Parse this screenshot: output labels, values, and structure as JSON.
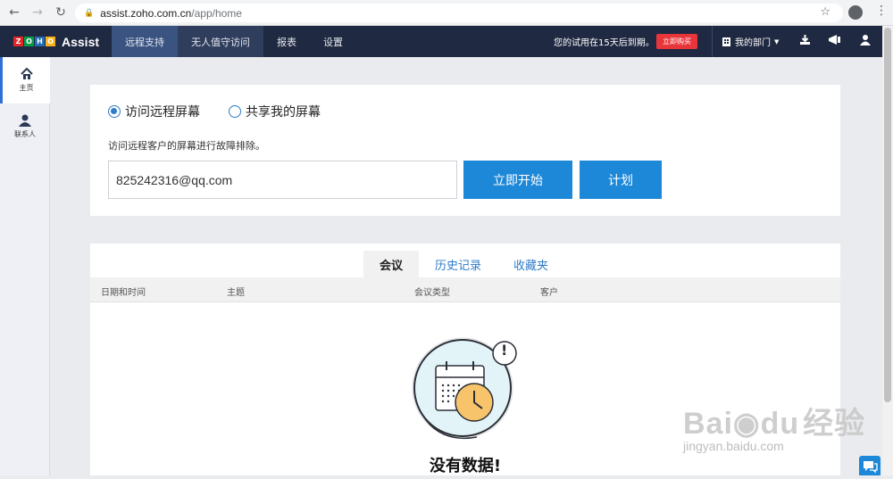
{
  "browser": {
    "url_host": "assist.zoho.com.cn",
    "url_path": "/app/home"
  },
  "header": {
    "logo_letters": [
      "Z",
      "O",
      "H",
      "O"
    ],
    "logo_colors": [
      "#e42527",
      "#089949",
      "#226db4",
      "#f9b21d"
    ],
    "logo_product": "Assist",
    "nav": [
      {
        "label": "远程支持"
      },
      {
        "label": "无人值守访问"
      },
      {
        "label": "报表"
      },
      {
        "label": "设置"
      }
    ],
    "trial_text": "您的试用在15天后到期。",
    "buy_label": "立即购买",
    "department_label": "我的部门"
  },
  "sidebar": {
    "items": [
      {
        "label": "主页",
        "icon": "home-icon"
      },
      {
        "label": "联系人",
        "icon": "contacts-icon"
      }
    ]
  },
  "session": {
    "option_remote": "访问远程屏幕",
    "option_share": "共享我的屏幕",
    "description": "访问远程客户的屏幕进行故障排除。",
    "email_value": "825242316@qq.com",
    "start_label": "立即开始",
    "schedule_label": "计划"
  },
  "meetings": {
    "tabs": [
      {
        "label": "会议"
      },
      {
        "label": "历史记录"
      },
      {
        "label": "收藏夹"
      }
    ],
    "columns": [
      "日期和时间",
      "主题",
      "会议类型",
      "客户"
    ],
    "empty_text": "没有数据!",
    "exclaim": "!"
  },
  "colors": {
    "accent": "#1e88d8",
    "header_bg": "#1f2941",
    "active_tab": "#3a5381",
    "buy": "#e8353a"
  },
  "watermark": {
    "brand": "Bai",
    "brand2": "du",
    "brand3": "经验",
    "site": "jingyan.baidu.com"
  }
}
